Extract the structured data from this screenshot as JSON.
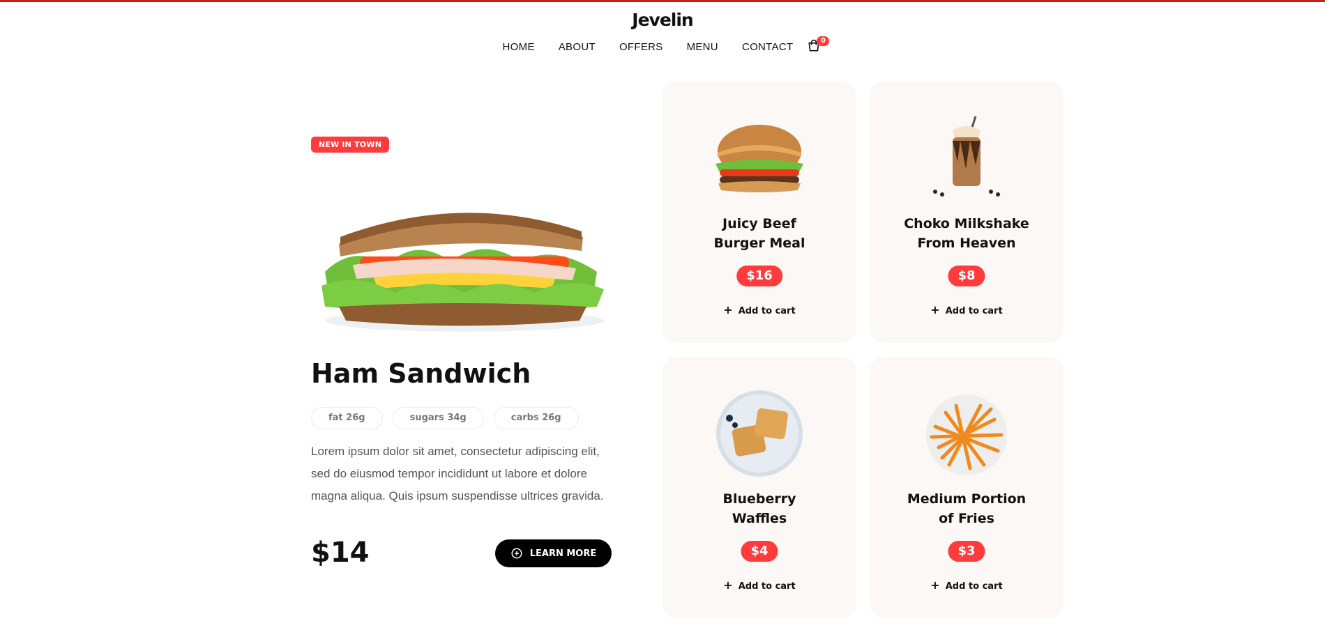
{
  "brand": {
    "logo": "Jevelin",
    "accent": "#ff3b3b",
    "topline": "#c81e1e"
  },
  "nav": {
    "items": [
      {
        "label": "HOME"
      },
      {
        "label": "ABOUT"
      },
      {
        "label": "OFFERS"
      },
      {
        "label": "MENU"
      },
      {
        "label": "CONTACT"
      }
    ],
    "cart_icon": "shopping-bag-icon",
    "cart_count": "0"
  },
  "hero": {
    "badge": "NEW IN TOWN",
    "title": "Ham Sandwich",
    "nutrition": [
      {
        "label": "fat 26g"
      },
      {
        "label": "sugars 34g"
      },
      {
        "label": "carbs 26g"
      }
    ],
    "description": "Lorem ipsum dolor sit amet, consectetur adipiscing elit, sed do eiusmod tempor incididunt ut labore et dolore magna aliqua. Quis ipsum suspendisse ultrices gravida.",
    "price": "$14",
    "cta_label": "LEARN MORE",
    "cta_icon": "plus-circle-icon"
  },
  "products": [
    {
      "name_line1": "Juicy Beef",
      "name_line2": "Burger Meal",
      "price": "$16",
      "add_label": "Add to cart",
      "icon": "burger-icon"
    },
    {
      "name_line1": "Choko Milkshake",
      "name_line2": "From Heaven",
      "price": "$8",
      "add_label": "Add to cart",
      "icon": "milkshake-icon"
    },
    {
      "name_line1": "Blueberry",
      "name_line2": "Waffles",
      "price": "$4",
      "add_label": "Add to cart",
      "icon": "waffles-icon"
    },
    {
      "name_line1": "Medium Portion",
      "name_line2": "of Fries",
      "price": "$3",
      "add_label": "Add to cart",
      "icon": "fries-icon"
    }
  ]
}
